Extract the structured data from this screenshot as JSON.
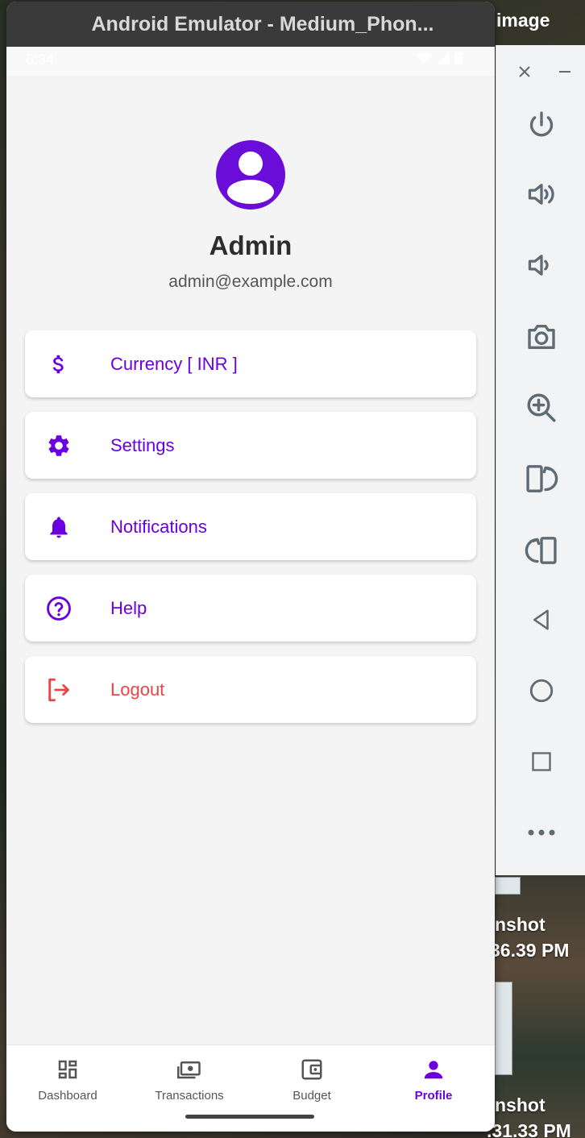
{
  "window": {
    "title": "Android Emulator - Medium_Phon...",
    "background_label": "image"
  },
  "status_bar": {
    "time": "6:34"
  },
  "profile": {
    "name": "Admin",
    "email": "admin@example.com"
  },
  "menu": {
    "items": [
      {
        "label": "Currency  [ INR ]",
        "icon": "dollar-icon"
      },
      {
        "label": "Settings",
        "icon": "gear-icon"
      },
      {
        "label": "Notifications",
        "icon": "bell-icon"
      },
      {
        "label": "Help",
        "icon": "help-circle-icon"
      },
      {
        "label": "Logout",
        "icon": "logout-icon",
        "color": "#e84545"
      }
    ]
  },
  "bottom_nav": {
    "items": [
      {
        "label": "Dashboard",
        "icon": "dashboard-icon"
      },
      {
        "label": "Transactions",
        "icon": "money-icon"
      },
      {
        "label": "Budget",
        "icon": "wallet-icon"
      },
      {
        "label": "Profile",
        "icon": "person-icon",
        "active": true
      }
    ]
  },
  "desktop": {
    "labels": [
      "nshot",
      "36.39 PM",
      "nshot",
      ".31.33 PM"
    ]
  },
  "colors": {
    "accent": "#6a00e0",
    "avatar": "#6a0dd8",
    "danger": "#e84545",
    "background": "#f4f4f4"
  }
}
